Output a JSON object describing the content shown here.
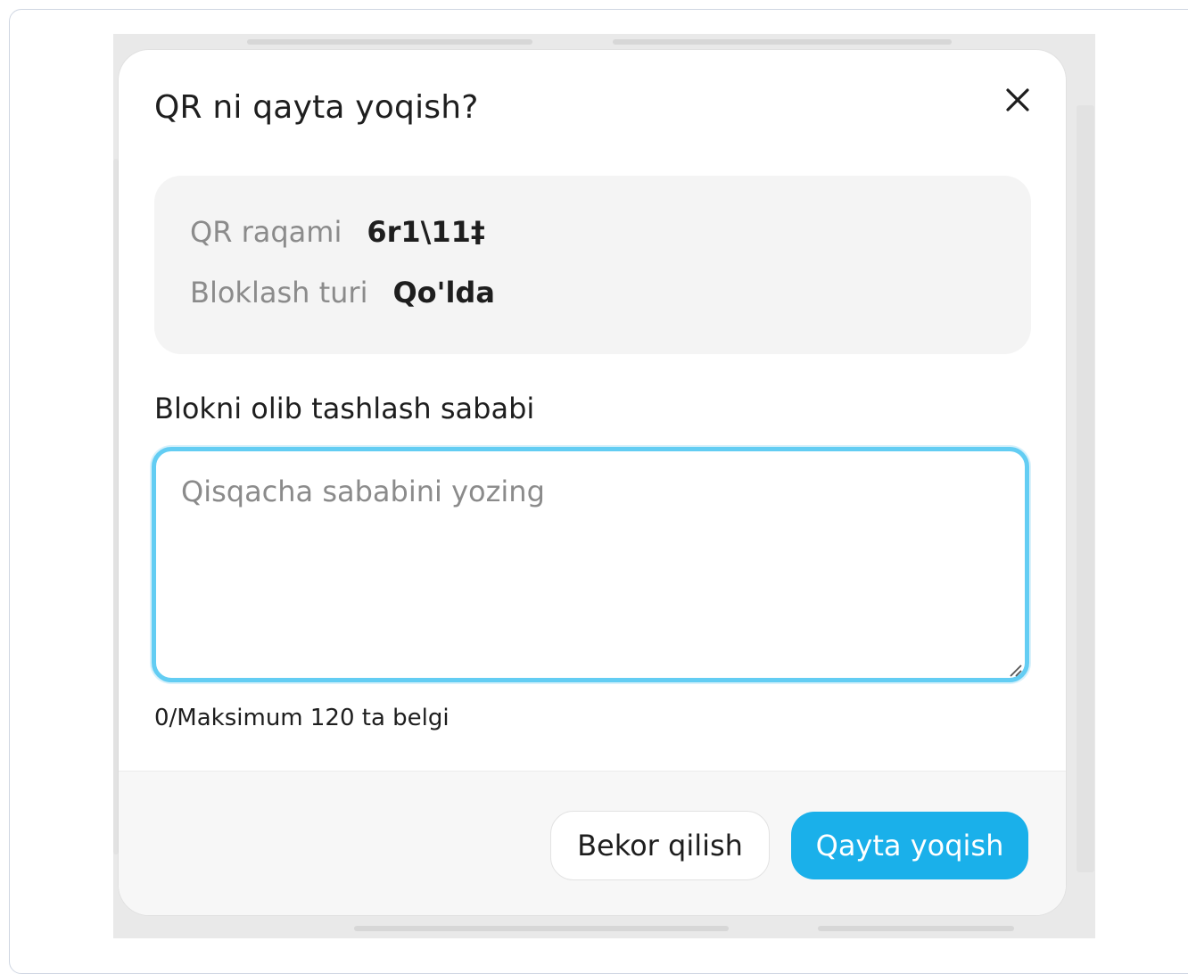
{
  "dialog": {
    "title": "QR ni qayta yoqish?",
    "close_icon": "close-icon"
  },
  "info": {
    "qr_number_label": "QR raqami",
    "qr_number_value": "6r1\\11‡",
    "block_type_label": "Bloklash turi",
    "block_type_value": "Qo'lda"
  },
  "reason": {
    "label": "Blokni olib tashlash sababi",
    "value": "",
    "placeholder": "Qisqacha sababini yozing",
    "counter": "0/Maksimum 120 ta belgi"
  },
  "actions": {
    "cancel_label": "Bekor qilish",
    "confirm_label": "Qayta yoqish"
  },
  "colors": {
    "accent": "#1ab0ea",
    "focus_border": "#63cdf3",
    "muted_text": "#8b8b8b",
    "card_background": "#f4f4f4"
  }
}
